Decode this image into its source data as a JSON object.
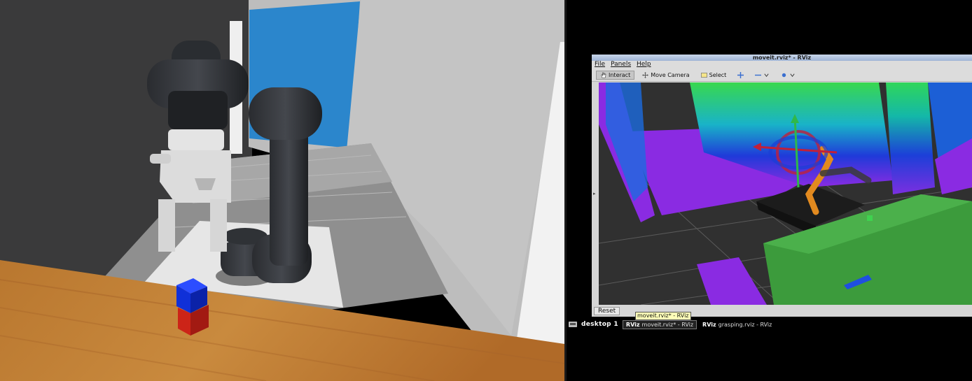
{
  "rviz": {
    "window_title": "moveit.rviz* - RViz",
    "menu": [
      "File",
      "Panels",
      "Help"
    ],
    "tools": {
      "interact": "Interact",
      "move_camera": "Move Camera",
      "select": "Select"
    },
    "reset_label": "Reset"
  },
  "taskbar": {
    "desktop_label": "desktop 1",
    "tooltip": "moveit.rviz* - RViz",
    "tasks": [
      {
        "logo": "RViz",
        "label": "moveit.rviz* - RViz"
      },
      {
        "logo": "RViz",
        "label": "grasping.rviz - RViz"
      }
    ]
  },
  "colors": {
    "pointcloud_purple": "#8a2be2",
    "table_green": "#3c9b3c",
    "cube_blue": "#1030d8",
    "cube_red": "#cc2418"
  }
}
